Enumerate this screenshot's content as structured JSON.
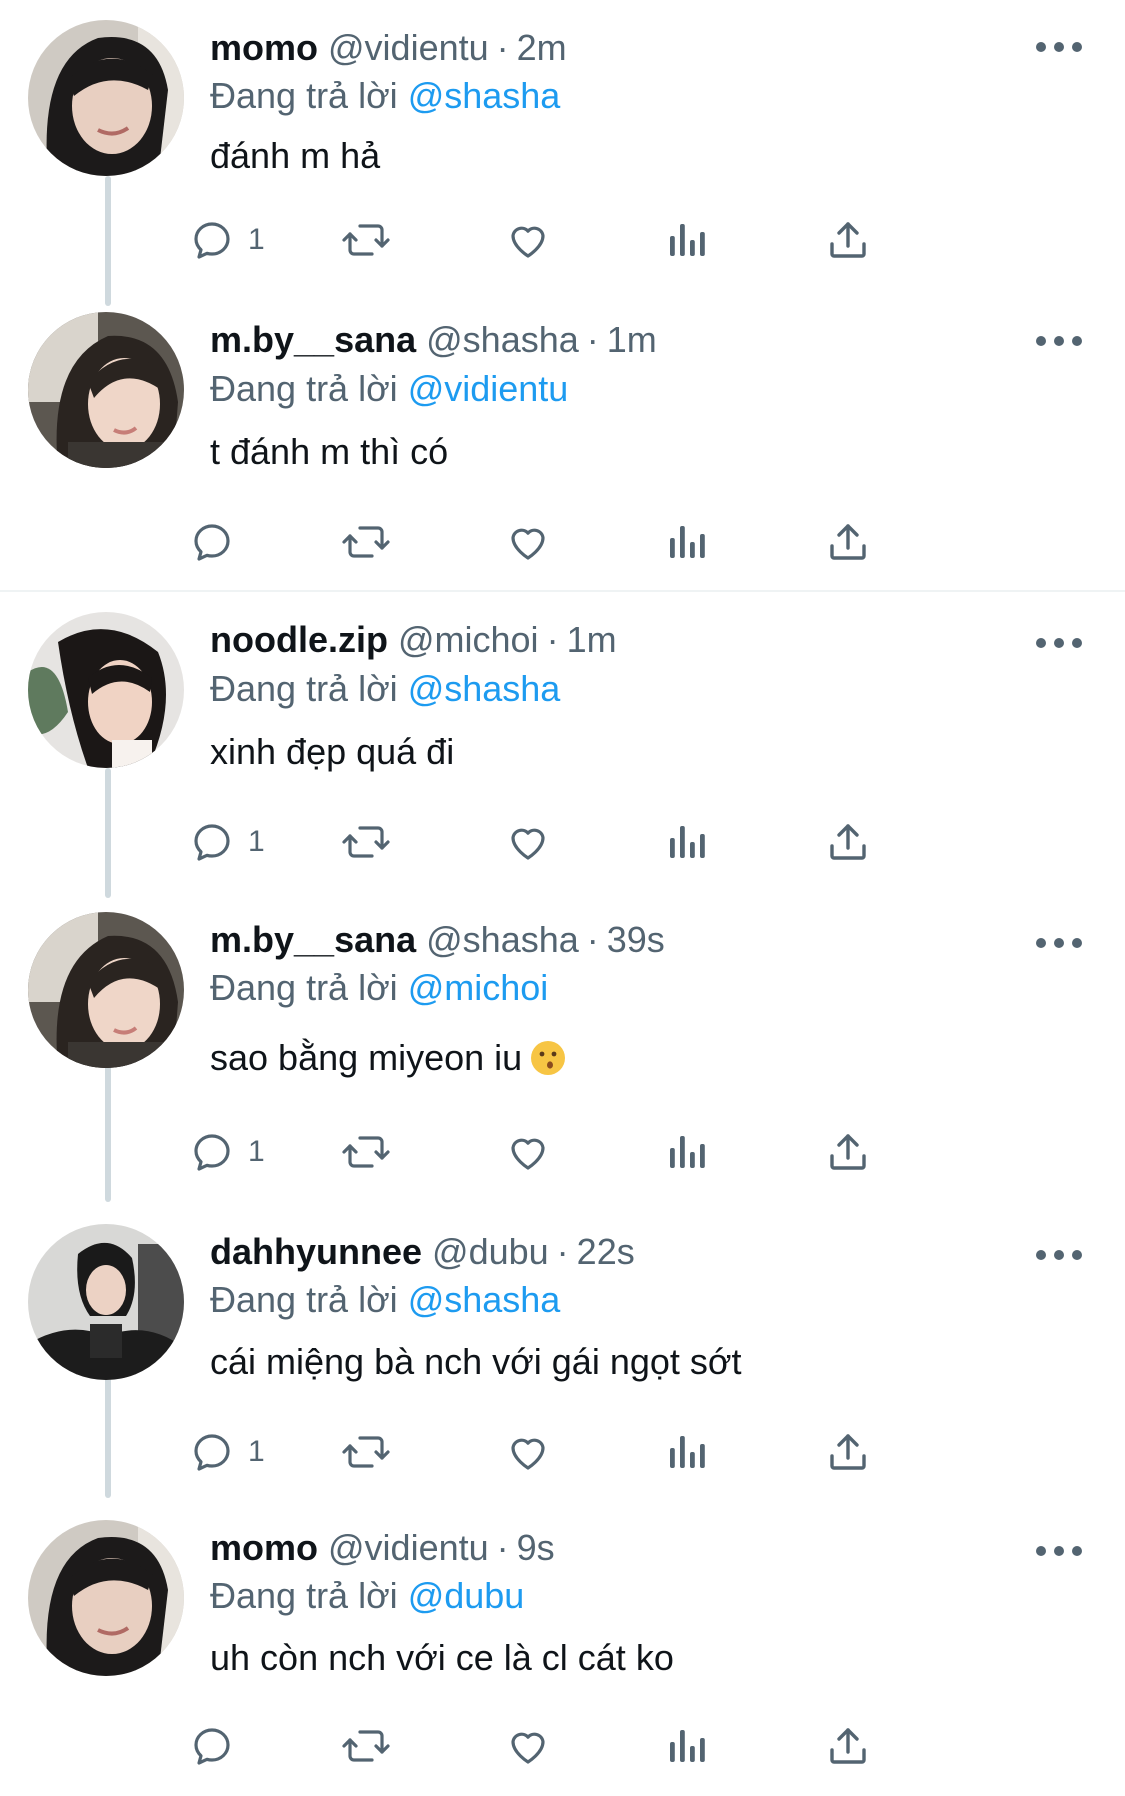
{
  "reply_prefix": "Đang trả lời",
  "tweets": [
    {
      "name": "momo",
      "handle": "@vidientu",
      "time": "2m",
      "reply_to": "@shasha",
      "text": "đánh m hả",
      "reply_count": "1",
      "avatar": "momo"
    },
    {
      "name": "m.by__sana",
      "handle": "@shasha",
      "time": "1m",
      "reply_to": "@vidientu",
      "text": "t đánh m thì có",
      "reply_count": "",
      "avatar": "sana"
    },
    {
      "name": "noodle.zip",
      "handle": "@michoi",
      "time": "1m",
      "reply_to": "@shasha",
      "text": "xinh đẹp quá đi",
      "reply_count": "1",
      "avatar": "noodle"
    },
    {
      "name": "m.by__sana",
      "handle": "@shasha",
      "time": "39s",
      "reply_to": "@michoi",
      "text": "sao bằng miyeon iu",
      "emoji": "kissing-face",
      "reply_count": "1",
      "avatar": "sana"
    },
    {
      "name": "dahhyunnee",
      "handle": "@dubu",
      "time": "22s",
      "reply_to": "@shasha",
      "text": "cái miệng bà nch với gái ngọt sớt",
      "reply_count": "1",
      "avatar": "dahyun"
    },
    {
      "name": "momo",
      "handle": "@vidientu",
      "time": "9s",
      "reply_to": "@dubu",
      "text": "uh còn nch với ce là cl cát ko",
      "reply_count": "",
      "avatar": "momo"
    }
  ],
  "colors": {
    "text": "#0f1419",
    "secondary": "#536471",
    "link": "#1d9bf0",
    "thread_line": "#cfd9de"
  },
  "icons": [
    "reply-icon",
    "retweet-icon",
    "like-icon",
    "views-icon",
    "share-icon",
    "more-icon"
  ]
}
